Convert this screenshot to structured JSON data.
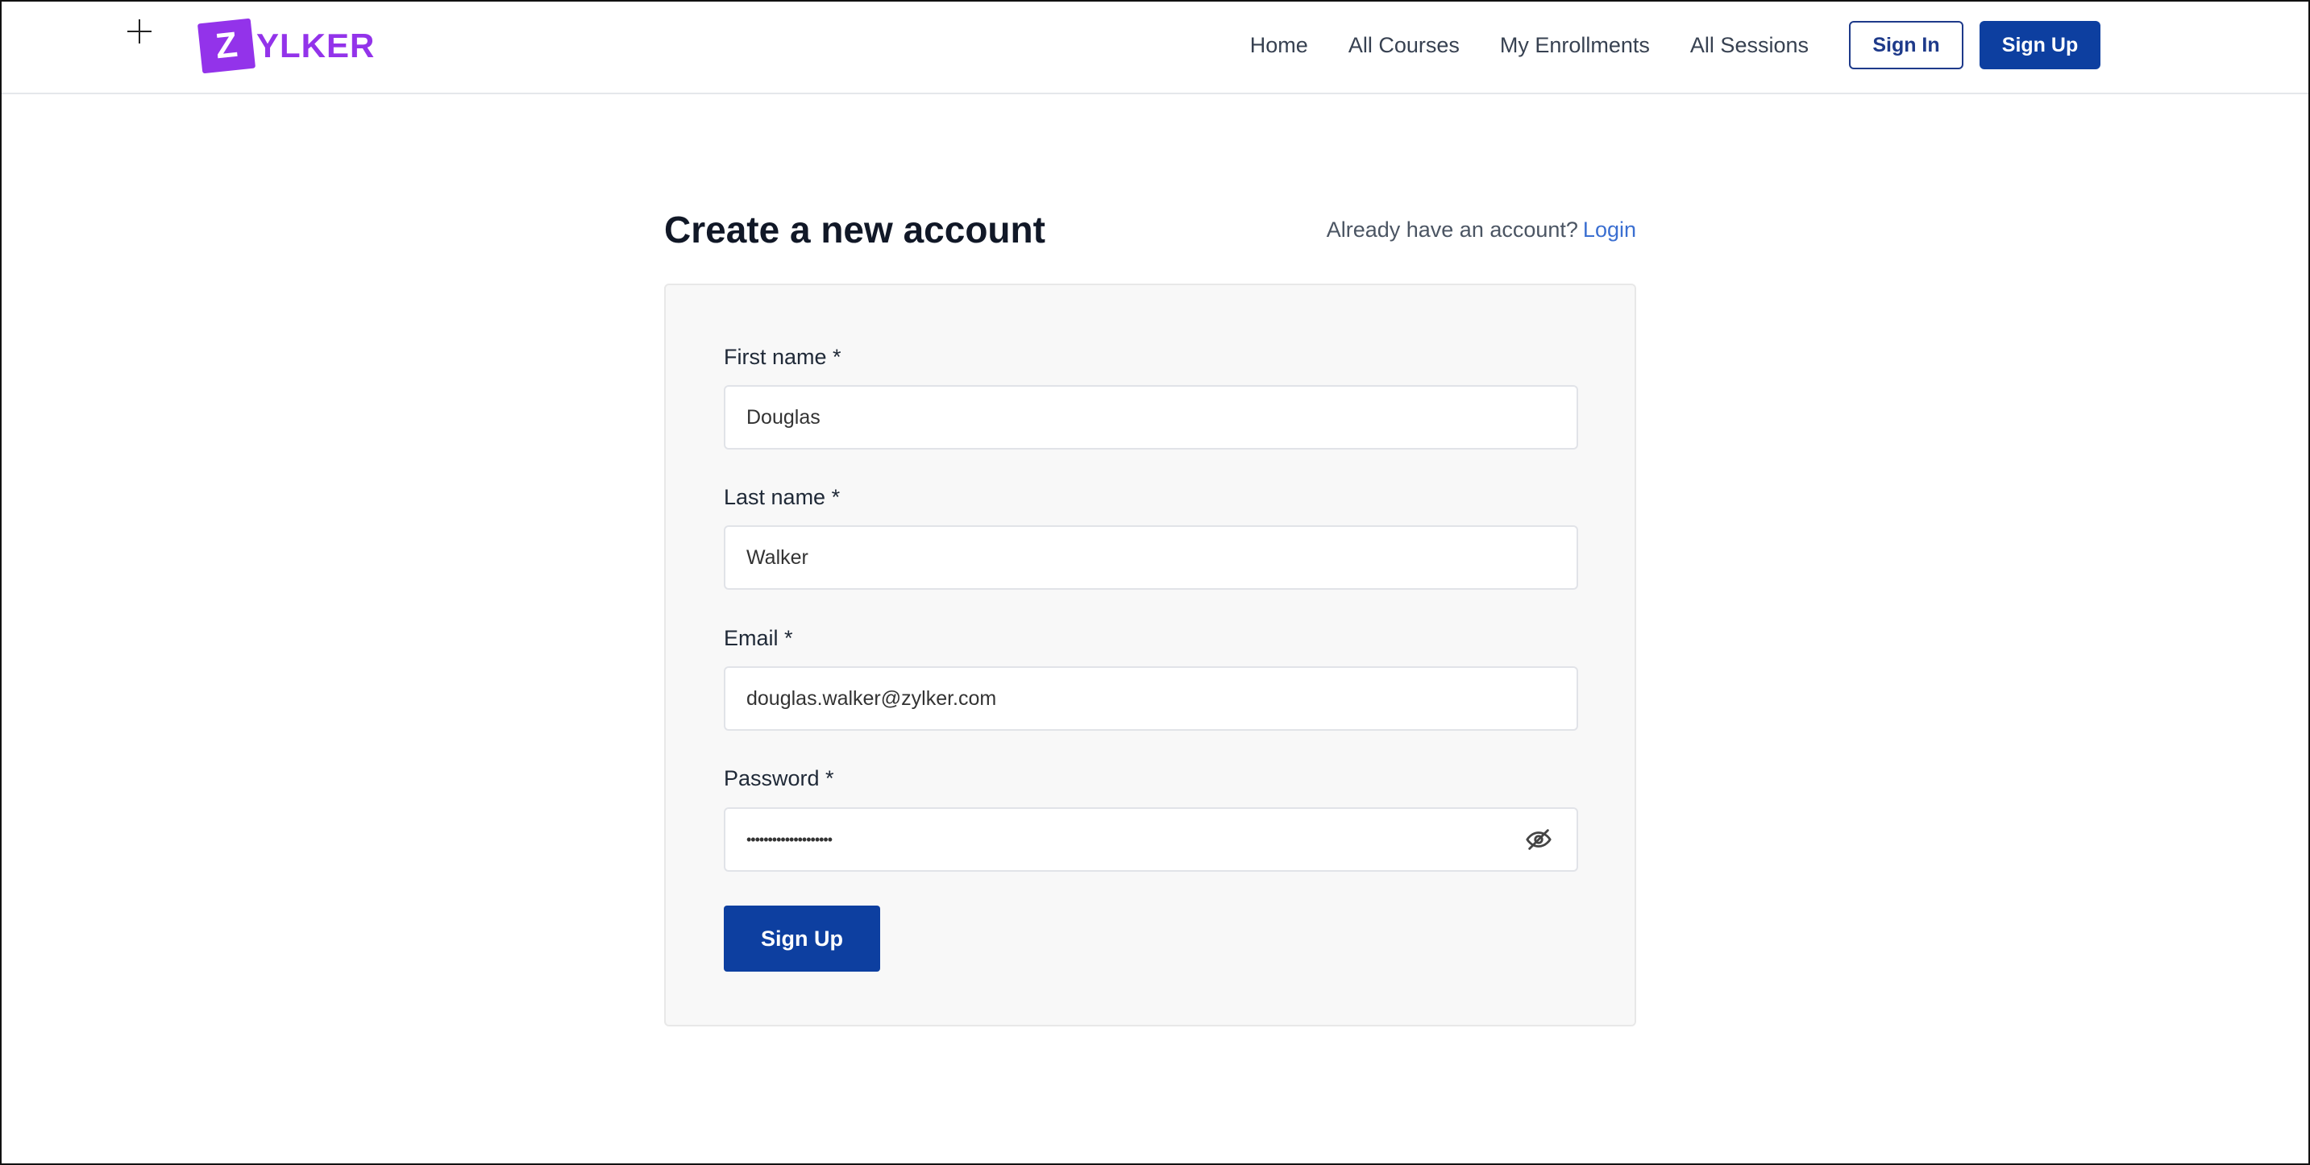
{
  "header": {
    "logo_letter": "Z",
    "logo_text": "YLKER",
    "nav": [
      {
        "label": "Home"
      },
      {
        "label": "All Courses"
      },
      {
        "label": "My Enrollments"
      },
      {
        "label": "All Sessions"
      }
    ],
    "sign_in_label": "Sign In",
    "sign_up_label": "Sign Up"
  },
  "main": {
    "title": "Create a new account",
    "login_prompt": "Already have an account?",
    "login_link": "Login"
  },
  "form": {
    "first_name": {
      "label": "First name *",
      "value": "Douglas"
    },
    "last_name": {
      "label": "Last name *",
      "value": "Walker"
    },
    "email": {
      "label": "Email *",
      "value": "douglas.walker@zylker.com"
    },
    "password": {
      "label": "Password *",
      "value": "••••••••••••••••••••"
    },
    "submit_label": "Sign Up"
  },
  "colors": {
    "brand_purple": "#9333ea",
    "primary_blue": "#0d3fa0",
    "link_blue": "#3b6fd1"
  },
  "icons": {
    "add": "plus-icon",
    "password_toggle": "eye-off-icon"
  }
}
